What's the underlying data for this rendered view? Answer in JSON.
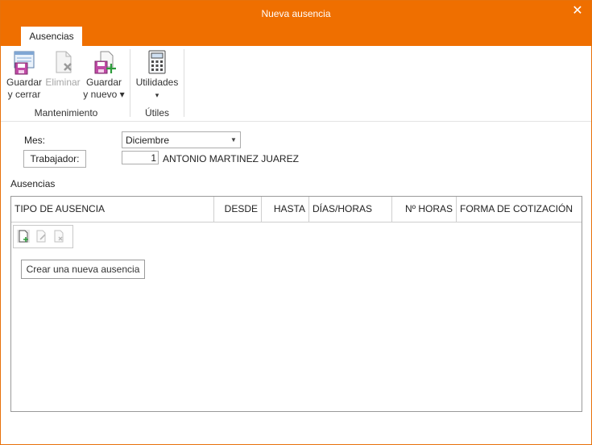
{
  "window": {
    "title": "Nueva ausencia",
    "close_glyph": "✕"
  },
  "tabs": [
    {
      "label": "Ausencias",
      "active": true
    }
  ],
  "ribbon": {
    "groups": [
      {
        "label": "Mantenimiento",
        "buttons": [
          {
            "line1": "Guardar",
            "line2": "y cerrar",
            "icon": "save-close-icon",
            "enabled": true
          },
          {
            "line1": "Eliminar",
            "line2": "",
            "icon": "delete-document-icon",
            "enabled": false
          },
          {
            "line1": "Guardar",
            "line2": "y nuevo ▾",
            "icon": "save-new-icon",
            "enabled": true
          }
        ]
      },
      {
        "label": "Útiles",
        "buttons": [
          {
            "line1": "Utilidades",
            "line2": "▾",
            "icon": "calculator-icon",
            "enabled": true
          }
        ]
      }
    ]
  },
  "form": {
    "mes_label": "Mes:",
    "mes_value": "Diciembre",
    "trabajador_label": "Trabajador:",
    "trabajador_id": "1",
    "trabajador_name": "ANTONIO MARTINEZ JUAREZ",
    "section_label": "Ausencias"
  },
  "grid": {
    "columns": [
      "TIPO DE AUSENCIA",
      "DESDE",
      "HASTA",
      "DÍAS/HORAS",
      "Nº HORAS",
      "FORMA DE COTIZACIÓN"
    ],
    "rows": [],
    "create_button": "Crear una nueva ausencia"
  },
  "colors": {
    "accent": "#ef6f00",
    "border": "#9a9a9a"
  }
}
